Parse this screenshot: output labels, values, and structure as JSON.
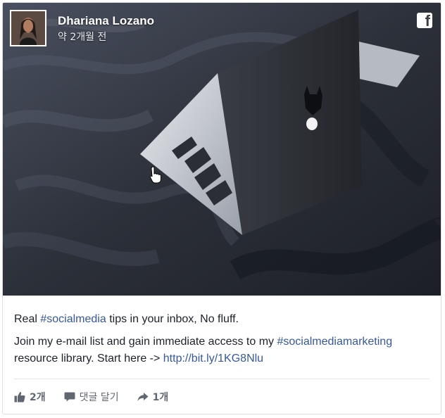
{
  "author": {
    "name": "Dhariana Lozano",
    "time": "약 2개월 전"
  },
  "icons": {
    "brand": "facebook-icon",
    "like": "thumbs-up-icon",
    "comment": "speech-bubble-icon",
    "share": "share-arrow-icon",
    "cursor": "hand-pointer-icon"
  },
  "post": {
    "line1_prefix": "Real ",
    "line1_tag": "#socialmedia",
    "line1_suffix": " tips in your inbox, No fluff.",
    "line2_prefix": "Join my e-mail list and gain immediate access to my ",
    "line2_tag": "#socialmediamarketing",
    "line2_middle": " resource library. Start here -> ",
    "line2_link": "http://bit.ly/1KG8Nlu"
  },
  "actions": {
    "like_count": "2개",
    "comment_label": "댓글 달기",
    "share_count": "1개"
  },
  "colors": {
    "link": "#365899",
    "text": "#1d2129",
    "muted": "#606770"
  }
}
